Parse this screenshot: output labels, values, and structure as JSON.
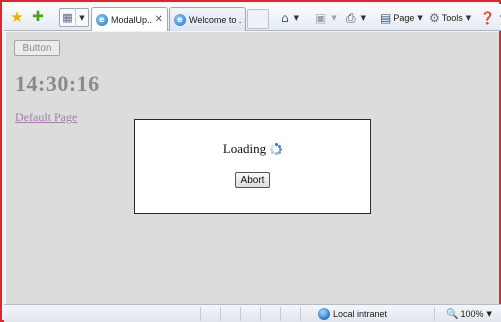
{
  "browser": {
    "tabs": [
      {
        "label": "ModalUp..."
      },
      {
        "label": "Welcome to ..."
      }
    ],
    "commands": {
      "page": "Page",
      "tools": "Tools"
    },
    "icons": {
      "favorites": "star-icon",
      "add_favorite": "add-favorite-icon",
      "quick_tabs": "quick-tabs-icon",
      "home": "home-icon",
      "feeds": "feeds-icon",
      "print": "print-icon",
      "help": "help-icon"
    }
  },
  "page": {
    "button_label": "Button",
    "clock": "14:30:16",
    "link_text": "Default Page"
  },
  "modal": {
    "loading_text": "Loading",
    "abort_label": "Abort"
  },
  "statusbar": {
    "zone": "Local intranet",
    "zoom": "100%"
  },
  "colors": {
    "window_border": "#d9282f",
    "content_background": "#dcdcdc",
    "visited_link": "#a27fa6"
  }
}
